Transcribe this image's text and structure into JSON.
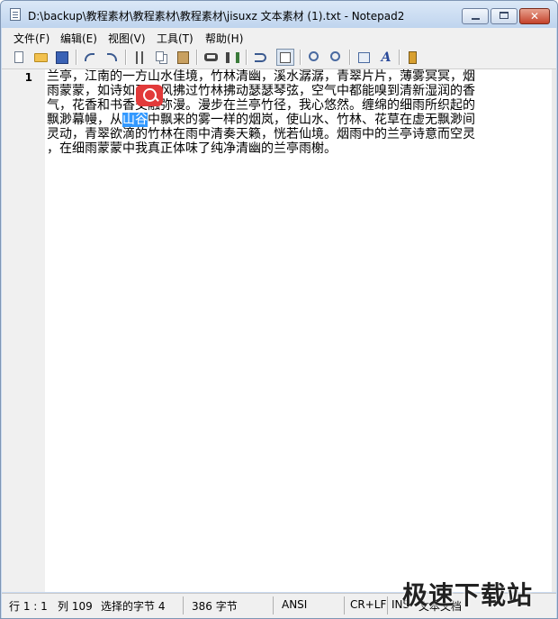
{
  "window": {
    "title": "D:\\backup\\教程素材\\教程素材\\教程素材\\jisuxz 文本素材 (1).txt - Notepad2",
    "close_glyph": "✕"
  },
  "menu": {
    "items": [
      {
        "label": "文件(F)"
      },
      {
        "label": "编辑(E)"
      },
      {
        "label": "视图(V)"
      },
      {
        "label": "工具(T)"
      },
      {
        "label": "帮助(H)"
      }
    ]
  },
  "toolbar": {
    "buttons": [
      {
        "icon": "new-file-icon"
      },
      {
        "icon": "open-folder-icon"
      },
      {
        "icon": "save-icon"
      },
      {
        "icon": "undo-icon"
      },
      {
        "icon": "redo-icon"
      },
      {
        "icon": "cut-icon"
      },
      {
        "icon": "copy-icon"
      },
      {
        "icon": "paste-icon"
      },
      {
        "icon": "find-icon"
      },
      {
        "icon": "replace-icon"
      },
      {
        "icon": "word-wrap-icon"
      },
      {
        "icon": "show-whitespace-icon",
        "active": true
      },
      {
        "icon": "zoom-in-icon"
      },
      {
        "icon": "zoom-out-icon"
      },
      {
        "icon": "settings-icon"
      },
      {
        "icon": "font-icon"
      },
      {
        "icon": "exit-icon"
      }
    ]
  },
  "editor": {
    "line_number": "1",
    "lines": [
      {
        "text": "兰亭，江南的一方山水佳境，竹林清幽，溪水潺潺，青翠片片，薄雾冥冥，烟"
      },
      {
        "text": "雨蒙蒙，如诗如画。风拂过竹林拂动瑟瑟琴弦，空气中都能嗅到清新湿润的香"
      },
      {
        "text": "气，花香和书香交融弥漫。漫步在兰亭竹径，我心悠然。缠绵的细雨所织起的"
      },
      {
        "before": "飘渺幕幔，从",
        "selected": "山谷",
        "after": "中飘来的雾一样的烟岚，使山水、竹林、花草在虚无飘渺间"
      },
      {
        "text": "灵动，青翠欲滴的竹林在雨中清奏天籁，恍若仙境。烟雨中的兰亭诗意而空灵"
      },
      {
        "text": "，在细雨蒙蒙中我真正体味了纯净清幽的兰亭雨榭。"
      }
    ]
  },
  "status": {
    "position": "行 1 : 1",
    "column": "列 109",
    "selection": "选择的字节 4",
    "size": "386 字节",
    "encoding": "ANSI",
    "line_ending": "CR+LF",
    "ins": "INS",
    "doc_type": "文本文档"
  },
  "watermark": {
    "text": "极速下载站"
  },
  "colors": {
    "selection": "#3399ff",
    "badge": "#e23a3a"
  }
}
